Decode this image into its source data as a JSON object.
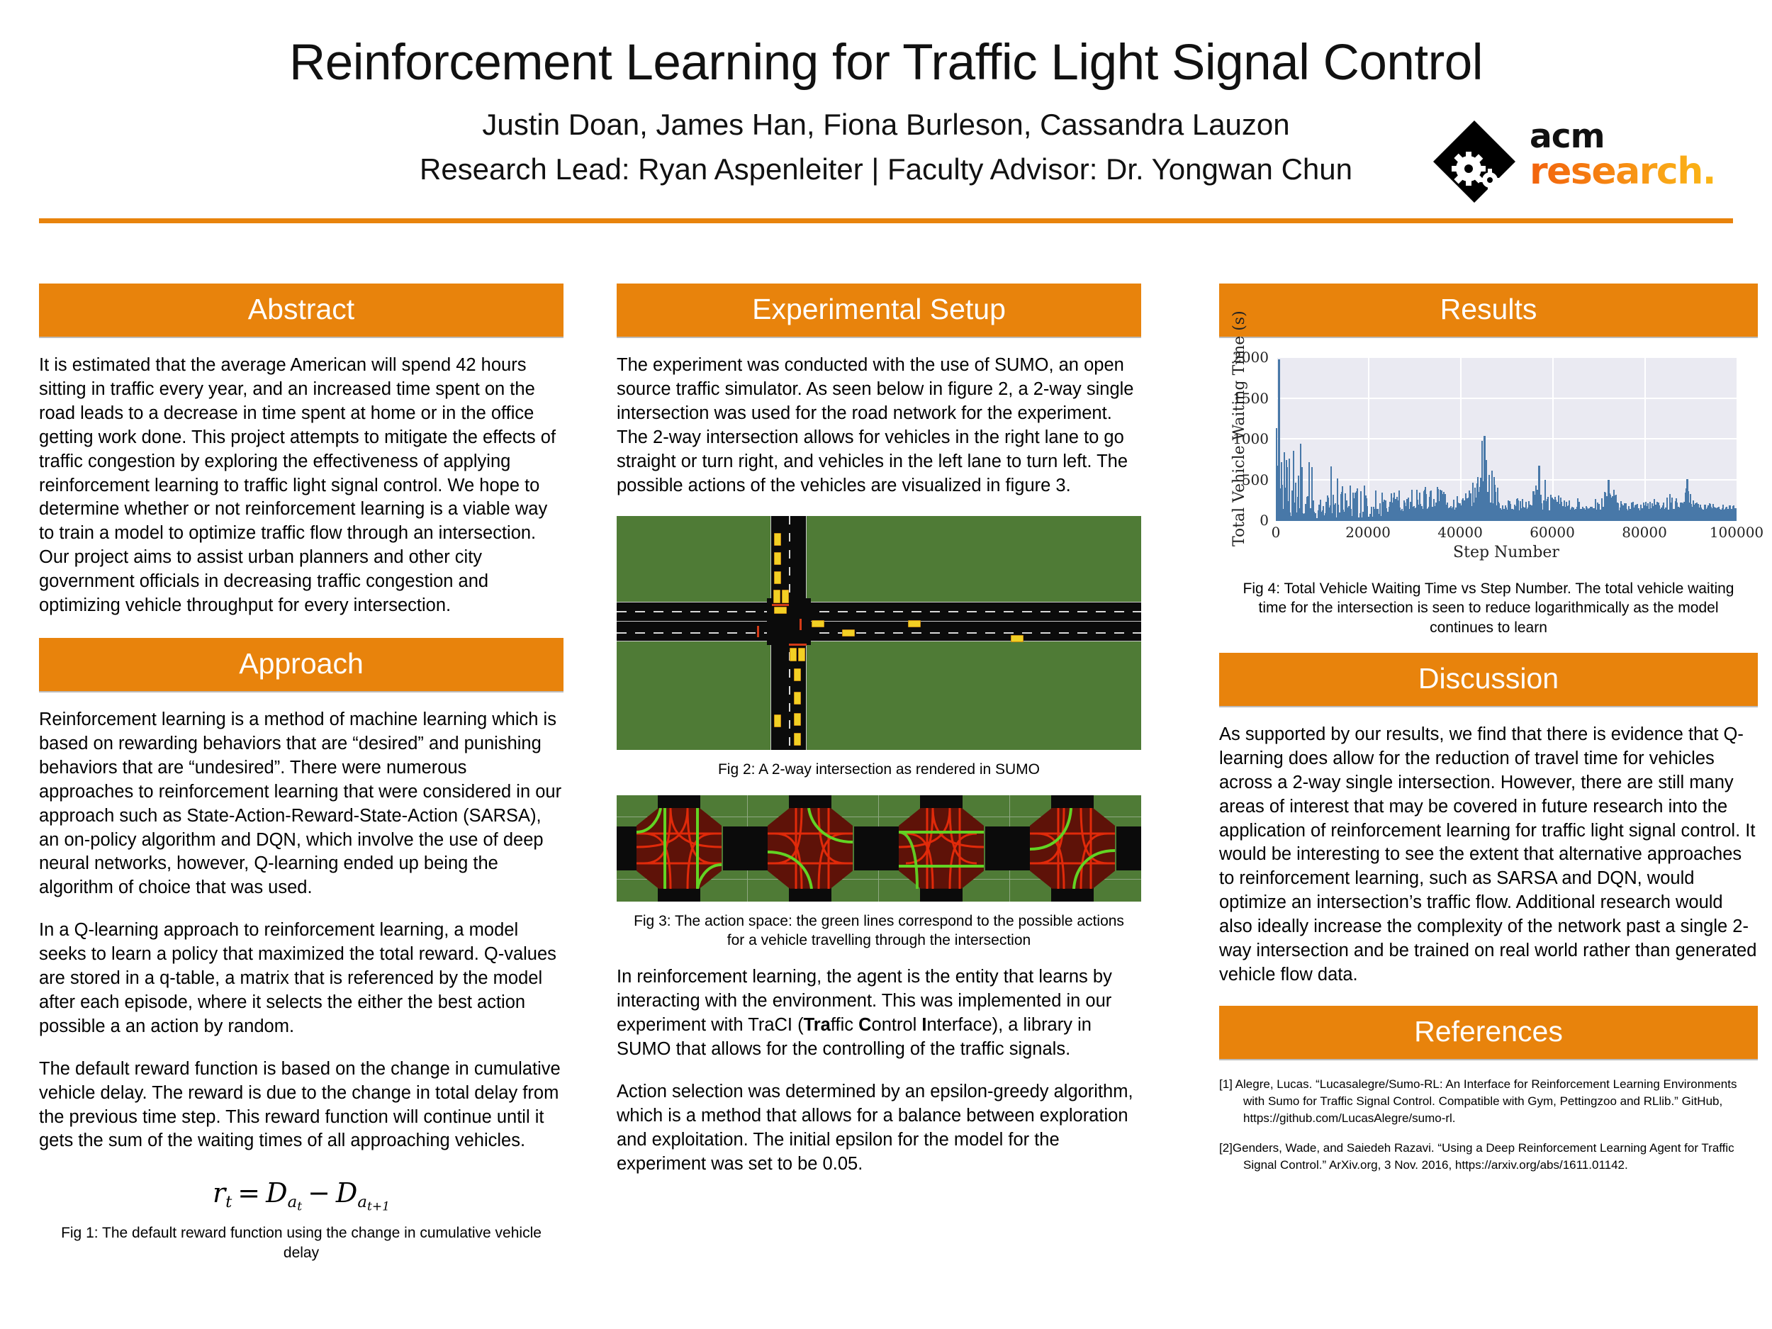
{
  "header": {
    "title": "Reinforcement Learning for Traffic Light Signal Control",
    "authors": "Justin Doan, James Han, Fiona Burleson, Cassandra Lauzon",
    "leads": "Research Lead: Ryan Aspenleiter | Faculty Advisor: Dr. Yongwan Chun",
    "logo_acm": "acm",
    "logo_research": "research.",
    "accent_color": "#E8830C"
  },
  "abstract": {
    "heading": "Abstract",
    "body": "It is estimated that the average American will spend 42 hours sitting in traffic every year, and an increased time spent on the road leads to a decrease in time spent at home or in the office getting work done. This project attempts to mitigate the effects of traffic congestion by exploring the effectiveness of applying reinforcement learning to traffic light signal control. We hope to determine whether or not reinforcement learning is a viable way to train a model to optimize traffic flow through an intersection. Our project aims to assist urban planners and other city government officials in decreasing traffic congestion and optimizing vehicle throughput for every intersection."
  },
  "approach": {
    "heading": "Approach",
    "p1": "Reinforcement learning is a method of machine learning which is based on rewarding behaviors that are “desired” and punishing behaviors that are “undesired”. There were numerous approaches to reinforcement learning that were considered in our approach such as State-Action-Reward-State-Action (SARSA), an on-policy algorithm and DQN, which involve the use of deep neural networks, however, Q-learning ended up being the algorithm of choice that was used.",
    "p2": "In a Q-learning approach to reinforcement learning, a model seeks to learn a policy that maximized the total reward. Q-values are stored in a q-table, a matrix that is referenced by the model after each episode, where it selects the either the best action possible a an action by random.",
    "p3": "The default reward function is based on the change in cumulative vehicle delay. The reward is due to the change in total delay from the previous time step. This reward function will continue until it gets the sum of the waiting times of all approaching vehicles.",
    "formula": "r_t = D_{a_t} - D_{a_{t+1}}",
    "fig1_caption": "Fig 1: The default reward function using the change in cumulative vehicle delay"
  },
  "experimental_setup": {
    "heading": "Experimental Setup",
    "p1": "The experiment was conducted with the use of SUMO, an open source traffic simulator. As seen below in figure 2, a 2-way single intersection was used for the road network for the experiment. The 2-way intersection allows for vehicles in the right lane to go straight or turn right, and vehicles in the left lane to turn left. The possible actions of the vehicles are visualized in figure 3.",
    "fig2_caption": "Fig 2: A 2-way intersection as rendered in SUMO",
    "fig3_caption": "Fig 3: The action space: the green lines correspond to the possible actions for a vehicle travelling through the intersection",
    "p2_part1": "In reinforcement learning, the agent is the entity that learns by interacting with the environment. This was implemented in our experiment with TraCI (",
    "p2_bold1": "Tra",
    "p2_mid1": "ffic ",
    "p2_bold2": "C",
    "p2_mid2": "ontrol ",
    "p2_bold3": "I",
    "p2_part2": "nterface), a library in SUMO that allows for the controlling of the traffic signals.",
    "p3": "Action selection was determined by an epsilon-greedy algorithm, which is a method that allows for a balance between exploration and exploitation. The initial epsilon for the model for the experiment was set to be 0.05."
  },
  "results": {
    "heading": "Results",
    "fig4_caption": "Fig 4: Total Vehicle Waiting Time vs Step Number. The total vehicle waiting time for the intersection is seen to reduce logarithmically as the model continues to learn"
  },
  "discussion": {
    "heading": "Discussion",
    "body": "As supported by our results, we find that there is evidence that Q-learning does allow for the reduction of travel time for vehicles across a 2-way single intersection. However, there are still many areas of interest that may be covered in future research into the application of reinforcement learning for traffic light signal control. It would be interesting to see the extent that  alternative approaches to reinforcement learning, such as SARSA and DQN, would optimize an intersection’s traffic flow. Additional research would also ideally increase the complexity of the network past a single 2-way intersection and be trained on real world rather than generated vehicle flow data."
  },
  "references": {
    "heading": "References",
    "items": [
      "[1] Alegre, Lucas. “Lucasalegre/Sumo-RL: An Interface for Reinforcement Learning Environments with Sumo for Traffic Signal Control. Compatible with Gym, Pettingzoo and RLlib.” GitHub, https://github.com/LucasAlegre/sumo-rl.",
      "[2]Genders, Wade, and Saiedeh Razavi. “Using a Deep Reinforcement Learning Agent for Traffic Signal Control.” ArXiv.org, 3 Nov. 2016, https://arxiv.org/abs/1611.01142."
    ]
  },
  "chart_data": {
    "type": "line",
    "title": "",
    "xlabel": "Step Number",
    "ylabel": "Total Vehicle Waiting Time (s)",
    "xlim": [
      0,
      100000
    ],
    "ylim": [
      0,
      2000
    ],
    "xticks": [
      0,
      20000,
      40000,
      60000,
      80000,
      100000
    ],
    "xtick_labels": [
      "0",
      "20000",
      "40000",
      "60000",
      "80000",
      "100000"
    ],
    "yticks": [
      0,
      500,
      1000,
      1500,
      2000
    ],
    "ytick_labels": [
      "0",
      "500",
      "1000",
      "1500",
      "2000"
    ],
    "grid": true,
    "legend": "none",
    "line_color": "#4878A8",
    "plot_background": "#EAEAF2",
    "series": [
      {
        "name": "Total Vehicle Waiting Time",
        "note": "Dense spiky per-step trace; envelope decays logarithmically from ~2000 s near step 0 to a ~150-200 s band by step 100000, with isolated late spikes.",
        "envelope_x": [
          0,
          500,
          1000,
          2000,
          4000,
          5000,
          7000,
          9000,
          12000,
          15000,
          16000,
          20000,
          25000,
          30000,
          35000,
          40000,
          45000,
          50000,
          55000,
          57000,
          60000,
          65000,
          70000,
          72000,
          75000,
          80000,
          85000,
          89000,
          92000,
          96000,
          100000
        ],
        "envelope_y": [
          1985,
          1930,
          1100,
          800,
          1240,
          1380,
          840,
          610,
          800,
          620,
          640,
          490,
          360,
          470,
          455,
          380,
          1045,
          300,
          300,
          675,
          350,
          300,
          285,
          505,
          260,
          250,
          330,
          515,
          230,
          215,
          200
        ],
        "baseline_x": [
          0,
          5000,
          10000,
          15000,
          20000,
          30000,
          40000,
          50000,
          60000,
          70000,
          80000,
          90000,
          100000
        ],
        "baseline_y": [
          40,
          35,
          30,
          25,
          20,
          120,
          130,
          130,
          125,
          130,
          130,
          140,
          140
        ],
        "peak_value": 1985,
        "peak_step": 400,
        "late_spikes": [
          {
            "step": 45000,
            "value": 1045
          },
          {
            "step": 57000,
            "value": 675
          },
          {
            "step": 72000,
            "value": 505
          },
          {
            "step": 89000,
            "value": 515
          }
        ]
      }
    ]
  }
}
